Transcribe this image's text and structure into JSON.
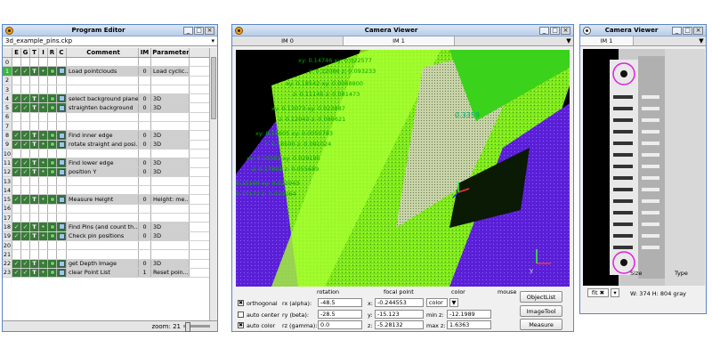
{
  "program_editor": {
    "title": "Program Editor",
    "file": "3d_example_pins.ckp",
    "headers": [
      "E",
      "G",
      "T",
      "I",
      "R",
      "C",
      "Comment",
      "IM",
      "Parameter"
    ],
    "rows": [
      {
        "num": "0",
        "comment": "",
        "im": "",
        "param": "",
        "active": false
      },
      {
        "num": "1",
        "comment": "Load pointclouds",
        "im": "0",
        "param": "Load cyclic...",
        "active": true,
        "selected": true
      },
      {
        "num": "2",
        "comment": "",
        "im": "",
        "param": "",
        "active": false
      },
      {
        "num": "3",
        "comment": "",
        "im": "",
        "param": "",
        "active": false
      },
      {
        "num": "4",
        "comment": "select background plane",
        "im": "0",
        "param": "3D",
        "active": true
      },
      {
        "num": "5",
        "comment": "straighten background",
        "im": "0",
        "param": "3D",
        "active": true
      },
      {
        "num": "6",
        "comment": "",
        "im": "",
        "param": "",
        "active": false
      },
      {
        "num": "7",
        "comment": "",
        "im": "",
        "param": "",
        "active": false
      },
      {
        "num": "8",
        "comment": "Find inner edge",
        "im": "0",
        "param": "3D",
        "active": true
      },
      {
        "num": "9",
        "comment": "rotate straight and posi...",
        "im": "0",
        "param": "3D",
        "active": true
      },
      {
        "num": "10",
        "comment": "",
        "im": "",
        "param": "",
        "active": false
      },
      {
        "num": "11",
        "comment": "Find lower edge",
        "im": "0",
        "param": "3D",
        "active": true
      },
      {
        "num": "12",
        "comment": "position Y",
        "im": "0",
        "param": "3D",
        "active": true
      },
      {
        "num": "13",
        "comment": "",
        "im": "",
        "param": "",
        "active": false
      },
      {
        "num": "14",
        "comment": "",
        "im": "",
        "param": "",
        "active": false
      },
      {
        "num": "15",
        "comment": "Measure Height",
        "im": "0",
        "param": "Height: me...",
        "active": true
      },
      {
        "num": "16",
        "comment": "",
        "im": "",
        "param": "",
        "active": false
      },
      {
        "num": "17",
        "comment": "",
        "im": "",
        "param": "",
        "active": false
      },
      {
        "num": "18",
        "comment": "Find Pins (and count th...",
        "im": "0",
        "param": "3D",
        "active": true
      },
      {
        "num": "19",
        "comment": "Check pin positions",
        "im": "0",
        "param": "3D",
        "active": true
      },
      {
        "num": "20",
        "comment": "",
        "im": "",
        "param": "",
        "active": false
      },
      {
        "num": "21",
        "comment": "",
        "im": "",
        "param": "",
        "active": false
      },
      {
        "num": "22",
        "comment": "get Depth Image",
        "im": "0",
        "param": "3D",
        "active": true
      },
      {
        "num": "23",
        "comment": "clear Point List",
        "im": "1",
        "param": "Reset poin...",
        "active": true
      }
    ],
    "zoom": "zoom: 21"
  },
  "camera_viewer_1": {
    "title": "Camera Viewer",
    "tabs": [
      "IM 0",
      "IM 1"
    ],
    "active_tab": 1,
    "annotations": [
      "xy: 0.14746 xy: 0.022577",
      "z: 0.12086  z: 0.093233",
      "xy: 0.18542 xy: 0.0068800",
      "z: 0.11145  z: 0.081473",
      "xy: 0.13073 xy: 0.023887",
      "z: 0.12043  z: 0.089621",
      "xy: 0.16605 xy: 0.0050783",
      "z: 0.18500  z: 0.091024",
      "xy: 0.15581 xy: 0.029195",
      "z: 0.17891  z: 0.055689",
      "0.15169 xy: 0.022943",
      "0.15172  z: 0.020264",
      "0.3359"
    ],
    "controls": {
      "rotation_header": "rotation",
      "focal_header": "focal point",
      "color_header": "color",
      "mouse_header": "mouse",
      "orthogonal": "orthogonal",
      "auto_center": "auto center",
      "auto_color": "auto color",
      "rx_label": "rx (alpha):",
      "rx_value": "-48.5",
      "ry_label": "ry (beta):",
      "ry_value": "-28.5",
      "rz_label": "rz (gamma):",
      "rz_value": "0.0",
      "x_label": "x:",
      "x_value": "-0.244553",
      "y_label": "y:",
      "y_value": "-15.123",
      "z_label": "z:",
      "z_value": "-5.28132",
      "color_value": "color",
      "min_z_label": "min z:",
      "min_z_value": "-12.1989",
      "max_z_label": "max z:",
      "max_z_value": "1.6363",
      "object_list": "ObjectList",
      "image_tool": "ImageTool",
      "measure": "Measure"
    }
  },
  "camera_viewer_2": {
    "title": "Camera Viewer",
    "tabs": [
      "IM 1"
    ],
    "zoom_label": "Zoom",
    "size_label": "Size",
    "type_label": "Type",
    "fit_label": "fit",
    "size_value": "W: 374  H: 804 gray"
  },
  "colors": {
    "window_border": "#5a87c8",
    "active_row": "#3b7a3b",
    "selected_num": "#3fb43f",
    "cloud_green": "#8cff1a",
    "cloud_purple": "#5a1fd6",
    "annotation": "#00c000"
  }
}
